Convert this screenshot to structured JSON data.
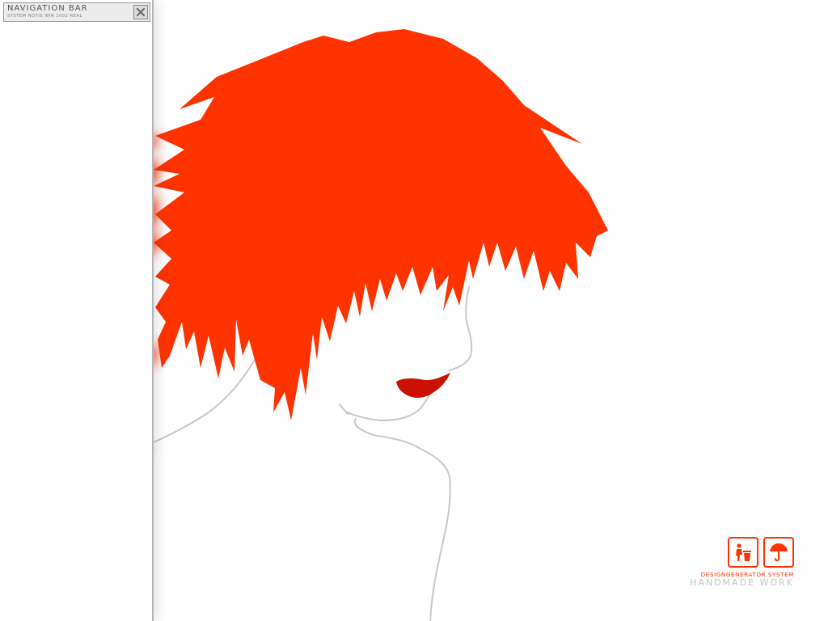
{
  "navigation": {
    "title": "NAVIGATION BAR",
    "subtitle": "SYSTEM NOTIS WIN 2002 REAL",
    "close_icon": "close-icon"
  },
  "branding": {
    "icons": [
      "trash-can-icon",
      "umbrella-icon"
    ],
    "tagline": "DESIGNGENERATOR.SYSTEM",
    "footer": "HANDMADE WORK"
  },
  "colors": {
    "hair": "#ff3300",
    "lips": "#cc1100",
    "outline": "#c8c8c8",
    "accent": "#ff3300",
    "footer_text": "#c4c4c4"
  }
}
